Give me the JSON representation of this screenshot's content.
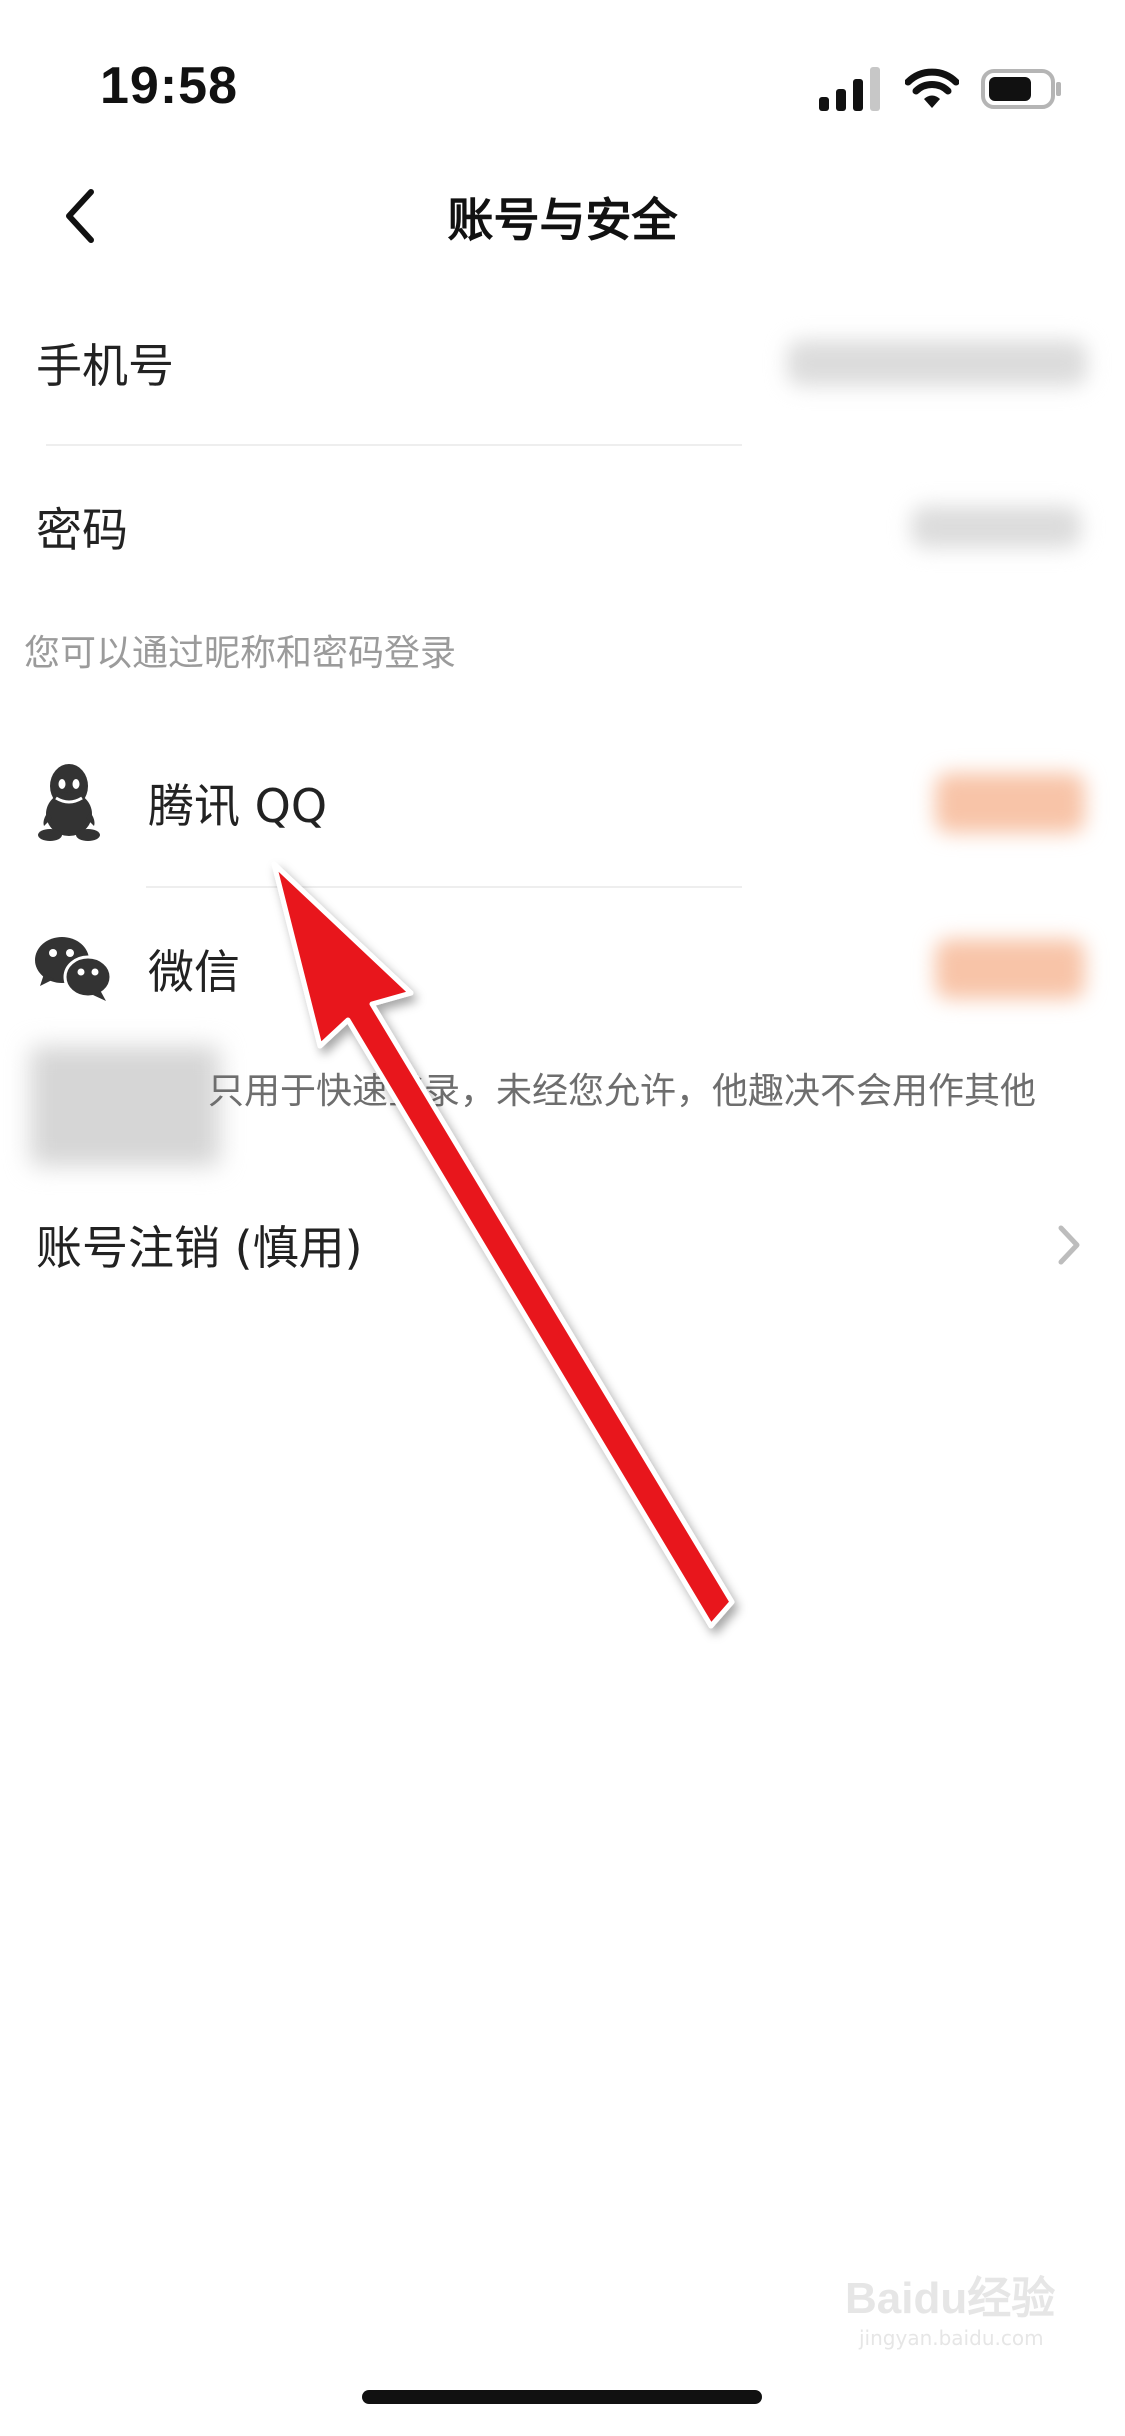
{
  "status_bar": {
    "time": "19:58"
  },
  "nav": {
    "title": "账号与安全",
    "back_icon": "chevron-left-icon"
  },
  "rows": {
    "phone": {
      "label": "手机号"
    },
    "password": {
      "label": "密码"
    },
    "login_hint": "您可以通过昵称和密码登录",
    "qq": {
      "label": "腾讯 QQ",
      "icon": "qq-icon"
    },
    "wechat": {
      "label": "微信",
      "icon": "wechat-icon"
    },
    "third_party_note": "只用于快速登录，未经您允许，他趣决不会用作其他",
    "deactivate": {
      "label": "账号注销 (慎用)",
      "icon": "chevron-right-icon"
    }
  },
  "watermark": {
    "text": "Baidu经验",
    "subtext": "jingyan.baidu.com"
  },
  "colors": {
    "background": "#ffffff",
    "label": "#222222",
    "hint": "#9b9b9b",
    "divider": "#eeeeee",
    "bind_accent_blurred": "#f7a27a",
    "annotation_arrow": "#e8141b"
  }
}
